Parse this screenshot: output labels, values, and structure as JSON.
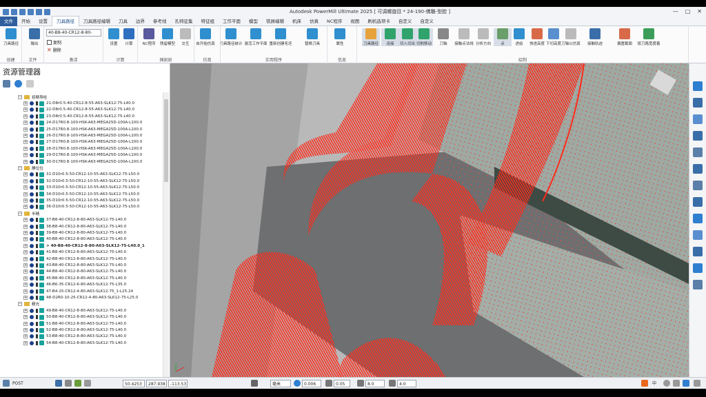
{
  "app": {
    "title": "Autodesk PowerMill Ultimate 2025  [ 可调螺旋目 * 24-190-佛雕-型腔 ]"
  },
  "tabs": [
    "文件",
    "开始",
    "设置",
    "刀具路径",
    "刀具路径编辑",
    "刀具",
    "边界",
    "参考线",
    "孔特征集",
    "特征组",
    "工作平面",
    "模型",
    "铣屑编辑",
    "机床",
    "仿真",
    "NC程序",
    "视图",
    "刷机选项卡",
    "自定义",
    "自定义"
  ],
  "active_tab": "刀具路径",
  "ribbon": {
    "toolpath_select": "40-B8-40-CR12-8-80-",
    "copy_label": "复制",
    "delete_label": "删除",
    "buttons": [
      {
        "label": "刀具路径",
        "group": "创建"
      },
      {
        "label": "输出",
        "group": "文件"
      },
      {
        "label": "设置",
        "group": "计算"
      },
      {
        "label": "计算",
        "group": "计算"
      },
      {
        "label": "NC程序",
        "group": "摊刻刻"
      },
      {
        "label": "残留模型",
        "group": "摊刻刻"
      },
      {
        "label": "交互",
        "group": "摊刻刻"
      },
      {
        "label": "自开始仿真",
        "group": "仿真"
      },
      {
        "label": "刀具路径统计",
        "group": "实用程序"
      },
      {
        "label": "激活工作平面",
        "group": "实用程序"
      },
      {
        "label": "重新创建毛坯",
        "group": "实用程序"
      },
      {
        "label": "替换刀具",
        "group": "实用程序"
      },
      {
        "label": "属性",
        "group": "信息"
      },
      {
        "label": "刀具路径",
        "group": "绘制"
      },
      {
        "label": "连接",
        "group": "绘制"
      },
      {
        "label": "切入切出",
        "group": "绘制"
      },
      {
        "label": "切削移动",
        "group": "绘制"
      },
      {
        "label": "刀轴",
        "group": "绘制"
      },
      {
        "label": "接触点法线",
        "group": "绘制"
      },
      {
        "label": "分析方向",
        "group": "绘制"
      },
      {
        "label": "点",
        "group": "绘制"
      },
      {
        "label": "进给",
        "group": "绘制"
      },
      {
        "label": "快进高度",
        "group": "绘制"
      },
      {
        "label": "下切高度",
        "group": "绘制"
      },
      {
        "label": "刀轴以仿真",
        "group": "绘制"
      },
      {
        "label": "接触轨迹",
        "group": "绘制"
      },
      {
        "label": "偏置截面",
        "group": "绘制"
      },
      {
        "label": "按刀路宽度着",
        "group": "绘制"
      }
    ],
    "groups": [
      "创建",
      "文件",
      "激活",
      "计算",
      "摊刻刻",
      "仿真",
      "实用程序",
      "信息",
      "绘制"
    ]
  },
  "explorer": {
    "title": "资源管理器",
    "rows": [
      {
        "type": "folder",
        "label": "初精导柱"
      },
      {
        "type": "item",
        "label": "21-D8r0.5-40-CR12-8-55-A63-SLK12-75-L40.0"
      },
      {
        "type": "item",
        "label": "22-D8r0.5-40-CR12-8-55-A63-SLK12-75-L40.0"
      },
      {
        "type": "item",
        "label": "23-D8r0.5-40-CR12-8-55-A63-SLK12-75-L40.0"
      },
      {
        "type": "item",
        "label": "24-D17R0.8-100-HSK-A63-MEGA25D-100A-L100.0"
      },
      {
        "type": "item",
        "label": "25-D17R0.8-100-HSK-A63-MEGA25D-100A-L100.0"
      },
      {
        "type": "item",
        "label": "26-D17R0.8-100-HSK-A63-MEGA25D-100A-L100.0"
      },
      {
        "type": "item",
        "label": "27-D17R0.8-100-HSK-A63-MEGA25D-100A-L100.0"
      },
      {
        "type": "item",
        "label": "28-D17R0.8-100-HSK-A63-MEGA25D-100A-L100.0"
      },
      {
        "type": "item",
        "label": "29-D17R0.8-100-HSK-A63-MEGA25D-100A-L100.0"
      },
      {
        "type": "item",
        "label": "30-D17R0.8-100-HSK-A63-MEGA25D-100A-L100.0"
      },
      {
        "type": "folder",
        "label": "静位位"
      },
      {
        "type": "item",
        "label": "31-D10r0.5-50-CR12-10-55-A63-SLK12-75-L50.0"
      },
      {
        "type": "item",
        "label": "32-D10r0.5-50-CR12-10-55-A63-SLK12-75-L50.0"
      },
      {
        "type": "item",
        "label": "33-D10r0.5-50-CR12-10-55-A63-SLK12-75-L50.0"
      },
      {
        "type": "item",
        "label": "34-D10r0.5-50-CR12-10-55-A63-SLK12-75-L50.0"
      },
      {
        "type": "item",
        "label": "35-D10r0.5-50-CR12-10-55-A63-SLK12-75-L50.0"
      },
      {
        "type": "item",
        "label": "36-D10r0.5-50-CR12-10-55-A63-SLK12-75-L50.0"
      },
      {
        "type": "folder",
        "label": "半精"
      },
      {
        "type": "item",
        "label": "37-B8-40-CR12-8-80-A63-SLK12-75-L40.0"
      },
      {
        "type": "item",
        "label": "38-B8-40-CR12-8-80-A63-SLK12-75-L40.0"
      },
      {
        "type": "item",
        "label": "39-B8-40-CR12-8-80-A63-SLK12-75-L40.0"
      },
      {
        "type": "item",
        "label": "40-B8-40-CR12-8-80-A63-SLK12-75-L40.0"
      },
      {
        "type": "item",
        "label": "> 40-B8-40-CR12-8-80-A63-SLK12-75-L40.0_1",
        "selected": true
      },
      {
        "type": "item",
        "label": "41-B8-40-CR12-8-80-A63-SLK12-75-L40.0"
      },
      {
        "type": "item",
        "label": "42-B8-40-CR12-8-80-A63-SLK12-75-L40.0"
      },
      {
        "type": "item",
        "label": "43-B8-40-CR12-8-80-A63-SLK12-75-L40.0"
      },
      {
        "type": "item",
        "label": "44-B8-40-CR12-8-80-A63-SLK12-75-L40.0"
      },
      {
        "type": "item",
        "label": "45-B8-40-CR12-8-80-A63-SLK12-75-L40.0"
      },
      {
        "type": "item",
        "label": "46-B6-35-CR12-6-80-A63-SLK12-75-L35.0"
      },
      {
        "type": "item",
        "label": "47-B4-25-CR12-4-80-A63-SLK12-75_1-L25.24"
      },
      {
        "type": "item",
        "label": "48-D2R0-10-25-CR12-4-80-A63-SLK12-75-L25.0"
      },
      {
        "type": "folder",
        "label": "精光"
      },
      {
        "type": "item",
        "label": "49-B8-40-CR12-8-80-A63-SLK12-75-L40.0"
      },
      {
        "type": "item",
        "label": "50-B8-40-CR12-8-80-A63-SLK12-75-L40.0"
      },
      {
        "type": "item",
        "label": "51-B8-40-CR12-8-80-A63-SLK12-75-L40.0"
      },
      {
        "type": "item",
        "label": "52-B8-40-CR12-8-80-A63-SLK12-75-L40.0"
      },
      {
        "type": "item",
        "label": "53-B8-40-CR12-8-80-A63-SLK12-75-L40.0"
      },
      {
        "type": "item",
        "label": "54-B8-40-CR12-8-80-A63-SLK12-75-L40.0"
      }
    ]
  },
  "status": {
    "post": "POST",
    "x": "50.4253",
    "y": "287.938",
    "z": "-113.53",
    "unit": "毫米",
    "tolerance": "0.006",
    "thickness": "0.05",
    "diameter": "8.0",
    "length": "4.0",
    "ime": "中"
  },
  "colors": {
    "toolpath": "#ff2a1a",
    "accent": "#2f5f9e",
    "background": "#bcbcbc"
  }
}
